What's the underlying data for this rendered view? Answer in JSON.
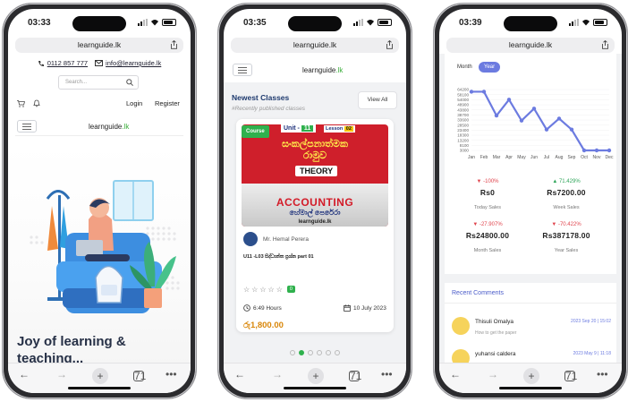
{
  "phone1": {
    "time": "03:33",
    "url": "learnguide.lk",
    "phone": "0112 857 777",
    "email": "info@learnguide.lk",
    "search_placeholder": "Search...",
    "login": "Login",
    "register": "Register",
    "logo_main": "learnguide",
    "logo_tld": ".lk",
    "hero_title": "Joy of learning & teaching...",
    "tab_count": "71"
  },
  "phone2": {
    "time": "03:35",
    "url": "learnguide.lk",
    "logo_main": "learnguide",
    "logo_tld": ".lk",
    "section_title": "Newest Classes",
    "section_subtitle": "#Recently published classes",
    "view_all": "View All",
    "course_badge": "Course",
    "unit_label": "Unit - ",
    "unit_num": "11",
    "lesson_label": "Lesson",
    "lesson_num": "02",
    "thumb_title_1": "සංකල්පනාත්මක",
    "thumb_title_2": "රාමුව",
    "thumb_theory": "THEORY",
    "thumb_subject": "ACCOUNTING",
    "thumb_teacher": "හේමාල් පෙරේරා",
    "thumb_site": "learnguide.lk",
    "teacher": "Mr. Hemal Perera",
    "course_title": "U11 -L03 සිද්ධාන්ත ප්‍රශ්න part 01",
    "rating_count": "0",
    "duration": "6:49 Hours",
    "date": "10 July 2023",
    "price": "රු1,800.00",
    "tab_count": "71",
    "active_dot": 1,
    "dot_count": 6
  },
  "phone3": {
    "time": "03:39",
    "url": "learnguide.lk",
    "toggle_month": "Month",
    "toggle_year": "Year",
    "stats": [
      {
        "change": "-100%",
        "dir": "down",
        "value": "Rs0",
        "label": "Today Sales"
      },
      {
        "change": "71.429%",
        "dir": "up",
        "value": "Rs7200.00",
        "label": "Week Sales"
      },
      {
        "change": "-27.907%",
        "dir": "down",
        "value": "Rs24800.00",
        "label": "Month Sales"
      },
      {
        "change": "-70.422%",
        "dir": "down",
        "value": "Rs387178.00",
        "label": "Year Sales"
      }
    ],
    "recent_comments": "Recent Comments",
    "comments": [
      {
        "name": "Thisuli Omalya",
        "date": "2023 Sep 20 | 15:02",
        "text": "How to get the paper"
      },
      {
        "name": "yuhansi caldera",
        "date": "2023 May 9 | 11:18",
        "text": ""
      }
    ],
    "tab_count": "71"
  },
  "chart_data": {
    "type": "line",
    "categories": [
      "Jan",
      "Feb",
      "Mar",
      "Apr",
      "May",
      "Jun",
      "Jul",
      "Aug",
      "Sep",
      "Oct",
      "Nov",
      "Dec"
    ],
    "y_ticks": [
      "64200",
      "58100",
      "54000",
      "48900",
      "43800",
      "38700",
      "33600",
      "28500",
      "23400",
      "18300",
      "13200",
      "8100",
      "3000"
    ],
    "ylim": [
      3000,
      64200
    ],
    "series": [
      {
        "values": [
          62000,
          62000,
          38000,
          54000,
          33000,
          45000,
          24000,
          35000,
          24000,
          3000,
          3000,
          3000
        ]
      }
    ],
    "colors": {
      "line": "#6c7be0"
    }
  }
}
